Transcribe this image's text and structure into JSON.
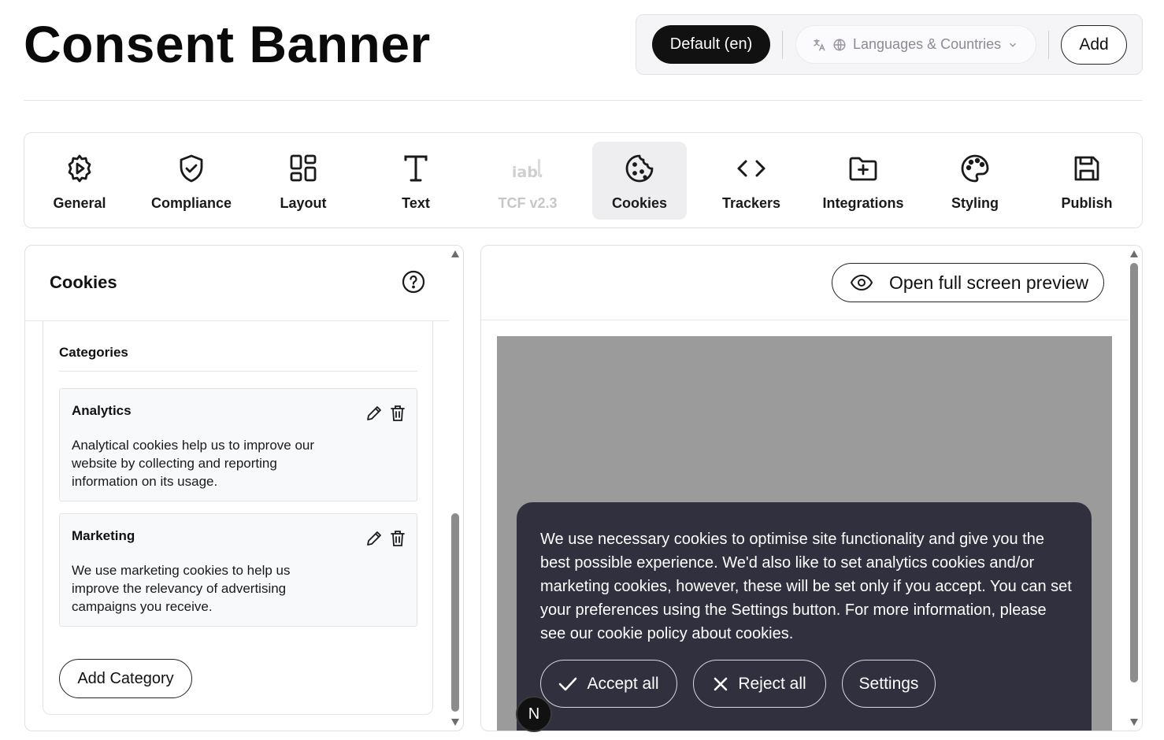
{
  "header": {
    "title": "Consent Banner",
    "default_lang": "Default (en)",
    "languages_placeholder": "Languages & Countries",
    "add_label": "Add"
  },
  "tabs": [
    {
      "label": "General",
      "icon": "gear-play-icon",
      "active": false,
      "disabled": false
    },
    {
      "label": "Compliance",
      "icon": "shield-check-icon",
      "active": false,
      "disabled": false
    },
    {
      "label": "Layout",
      "icon": "layout-grid-icon",
      "active": false,
      "disabled": false
    },
    {
      "label": "Text",
      "icon": "text-icon",
      "active": false,
      "disabled": false
    },
    {
      "label": "TCF v2.3",
      "icon": "iab-logo-icon",
      "active": false,
      "disabled": true
    },
    {
      "label": "Cookies",
      "icon": "cookie-icon",
      "active": true,
      "disabled": false
    },
    {
      "label": "Trackers",
      "icon": "code-icon",
      "active": false,
      "disabled": false
    },
    {
      "label": "Integrations",
      "icon": "folder-plus-icon",
      "active": false,
      "disabled": false
    },
    {
      "label": "Styling",
      "icon": "palette-icon",
      "active": false,
      "disabled": false
    },
    {
      "label": "Publish",
      "icon": "save-icon",
      "active": false,
      "disabled": false
    }
  ],
  "cookies_panel": {
    "title": "Cookies",
    "categories_heading": "Categories",
    "categories": [
      {
        "name": "Analytics",
        "description": "Analytical cookies help us to improve our website by collecting and reporting information on its usage."
      },
      {
        "name": "Marketing",
        "description": "We use marketing cookies to help us improve the relevancy of advertising campaigns you receive."
      }
    ],
    "add_category_label": "Add Category"
  },
  "preview": {
    "open_preview_label": "Open full screen preview",
    "banner_text": "We use necessary cookies to optimise site functionality and give you the best possible experience. We'd also like to set analytics cookies and/or marketing cookies, however, these will be set only if you accept. You can set your preferences using the Settings button. For more information, please see our cookie policy about cookies.",
    "accept_label": "Accept all",
    "reject_label": "Reject all",
    "settings_label": "Settings"
  },
  "badge": {
    "letter": "N"
  },
  "colors": {
    "banner_bg": "#30303f",
    "preview_bg": "#9b9b9b",
    "active_tab": "#eeedef"
  }
}
